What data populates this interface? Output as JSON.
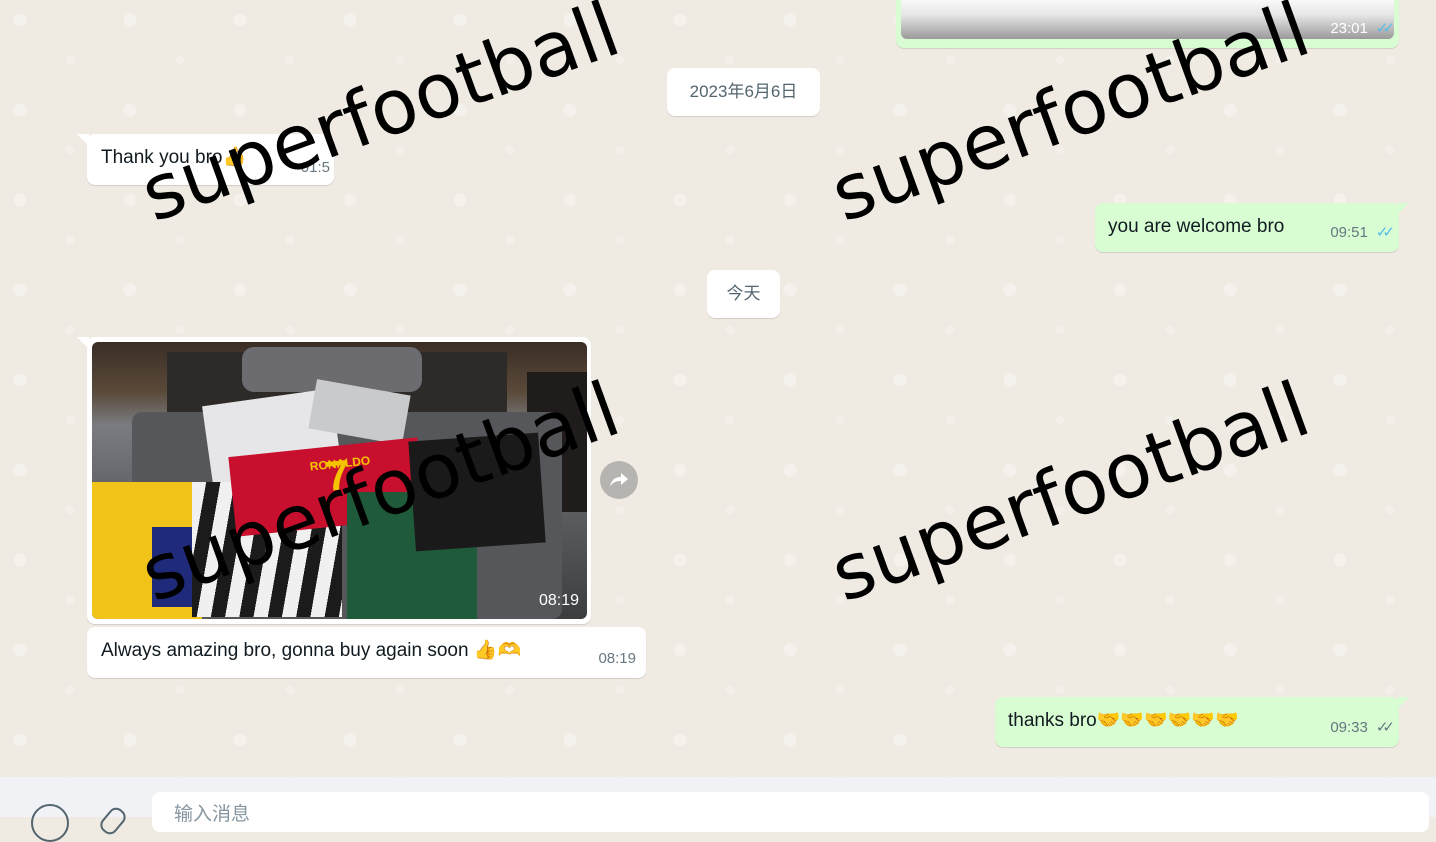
{
  "messages": {
    "top_out": {
      "time": "23:01"
    },
    "date1": "2023年6月6日",
    "thanks_in": {
      "text": "Thank you bro👍",
      "time": "01:5"
    },
    "welcome_out": {
      "text": "you are welcome bro",
      "time": "09:51"
    },
    "date2": "今天",
    "photo_in": {
      "time": "08:19"
    },
    "amazing_in": {
      "text": "Always amazing bro, gonna buy again soon 👍🫶",
      "time": "08:19"
    },
    "thanks_out": {
      "text": "thanks bro🤝🤝🤝🤝🤝🤝",
      "time": "09:33"
    }
  },
  "photo": {
    "jersey_name": "RONALDO",
    "jersey_number": "7"
  },
  "watermark": "superfootball",
  "composer": {
    "placeholder": "输入消息"
  },
  "icons": {
    "read": "double-check-icon",
    "forward": "forward-icon",
    "emoji": "emoji-icon",
    "attach": "attach-icon"
  }
}
